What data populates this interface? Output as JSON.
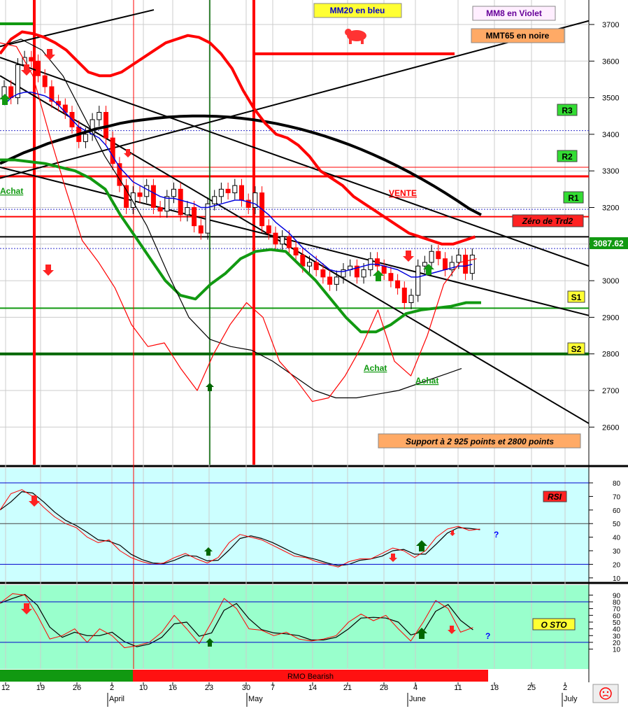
{
  "chart_data": [
    {
      "type": "candlestick",
      "yaxis": {
        "ticks": [
          3700,
          3600,
          3500,
          3400,
          3300,
          3200,
          3100,
          3000,
          2900,
          2800,
          2700,
          2600
        ]
      },
      "last_price": "3087.62",
      "labels": {
        "mm20": "MM20 en bleu",
        "mm8": "MM8 en Violet",
        "mmt65": "MMT65 en noire",
        "r3": "R3",
        "r2": "R2",
        "r1": "R1",
        "s1": "S1",
        "s2": "S2",
        "zero_trd2": "Zéro de Trd2",
        "vente": "VENTE",
        "achat_left": "Achat",
        "achat_mid": "Achat",
        "achat_right": "Achat",
        "support": "Support à 2 925 points et 2800 points"
      },
      "levels": {
        "r3": 3410,
        "r2": 3285,
        "r1": 3195,
        "zero": 3175,
        "black": 3120,
        "pivot_dash": 3088,
        "s1": 2925,
        "s2": 2800
      },
      "series": {
        "close": [
          3530,
          3500,
          3590,
          3610,
          3600,
          3560,
          3530,
          3490,
          3480,
          3460,
          3420,
          3380,
          3400,
          3440,
          3460,
          3390,
          3320,
          3260,
          3200,
          3240,
          3230,
          3260,
          3200,
          3190,
          3230,
          3250,
          3180,
          3200,
          3150,
          3130,
          3210,
          3230,
          3250,
          3240,
          3260,
          3220,
          3200,
          3240,
          3150,
          3130,
          3100,
          3120,
          3090,
          3070,
          3040,
          3050,
          3030,
          3010,
          2990,
          3010,
          3030,
          3040,
          3010,
          3030,
          3060,
          3040,
          3020,
          3000,
          2980,
          2940,
          2960,
          3040,
          3050,
          3080,
          3060,
          3030,
          3050,
          3070,
          3020,
          3070
        ],
        "mm20_blue": [
          3480,
          3500,
          3510,
          3515,
          3515,
          3510,
          3505,
          3495,
          3480,
          3460,
          3440,
          3420,
          3410,
          3400,
          3390,
          3370,
          3340,
          3310,
          3290,
          3270,
          3260,
          3250,
          3240,
          3230,
          3225,
          3225,
          3220,
          3215,
          3210,
          3200,
          3200,
          3205,
          3210,
          3215,
          3220,
          3220,
          3215,
          3210,
          3195,
          3180,
          3160,
          3145,
          3130,
          3110,
          3090,
          3075,
          3060,
          3045,
          3030,
          3025,
          3025,
          3030,
          3035,
          3040,
          3045,
          3045,
          3040,
          3035,
          3030,
          3020,
          3010,
          3010,
          3015,
          3020,
          3025,
          3030,
          3035,
          3040,
          3040,
          3045
        ],
        "mmt65_thick": [
          3320,
          3335,
          3350,
          3362,
          3375,
          3385,
          3395,
          3405,
          3415,
          3422,
          3430,
          3436,
          3440,
          3444,
          3447,
          3449,
          3450,
          3450,
          3449,
          3447,
          3444,
          3440,
          3435,
          3429,
          3422,
          3414,
          3405,
          3395,
          3384,
          3372,
          3359,
          3345,
          3330,
          3314,
          3297,
          3279,
          3260,
          3240,
          3219,
          3197,
          3180
        ],
        "mm8_red": [
          3620,
          3660,
          3680,
          3675,
          3665,
          3650,
          3630,
          3600,
          3570,
          3560,
          3560,
          3570,
          3590,
          3610,
          3630,
          3650,
          3660,
          3670,
          3665,
          3650,
          3620,
          3580,
          3520,
          3470,
          3430,
          3400,
          3390,
          3370,
          3340,
          3300,
          3280,
          3260,
          3230,
          3210,
          3190,
          3170,
          3150,
          3130,
          3120,
          3110,
          3100,
          3100,
          3110,
          3120
        ]
      }
    },
    {
      "type": "line",
      "yaxis": {
        "ticks": [
          80,
          70,
          60,
          50,
          40,
          30,
          20,
          10
        ]
      },
      "title": "RSI",
      "note": "?",
      "levels": [
        80,
        50,
        20
      ]
    },
    {
      "type": "line",
      "yaxis": {
        "ticks": [
          90,
          80,
          70,
          60,
          50,
          40,
          30,
          20,
          10
        ]
      },
      "title": "O STO",
      "note": "?",
      "levels": [
        80,
        20
      ]
    }
  ],
  "timeline": {
    "days": [
      "12",
      "19",
      "26",
      "2",
      "10",
      "16",
      "23",
      "30",
      "7",
      "14",
      "21",
      "28",
      "4",
      "11",
      "18",
      "25",
      "2"
    ],
    "months": [
      "April",
      "May",
      "June",
      "July"
    ],
    "bar_label": "RMO Bearish",
    "colors": {
      "bull": "#119911",
      "bear": "#ff1111"
    }
  }
}
